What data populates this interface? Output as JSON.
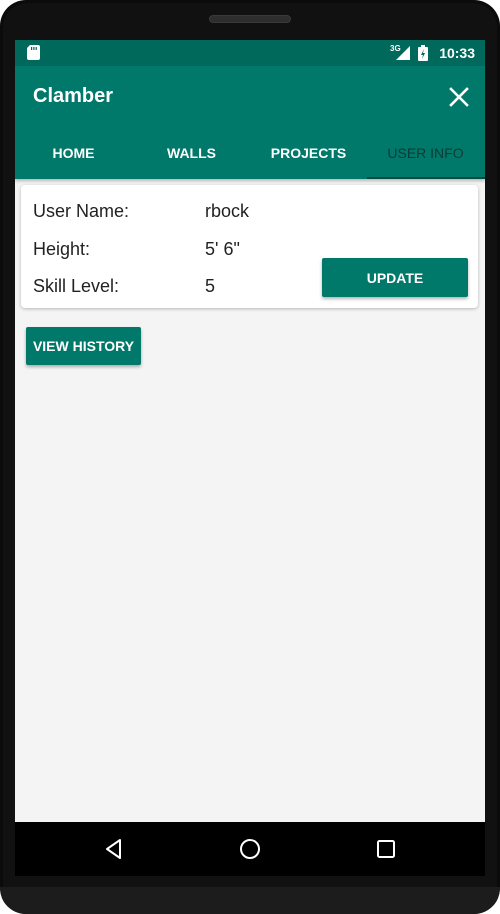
{
  "status_bar": {
    "network_type": "3G",
    "time": "10:33",
    "icons": [
      "sd-card-icon",
      "signal-icon",
      "battery-icon"
    ]
  },
  "app_bar": {
    "title": "Clamber",
    "close_icon": "close-icon"
  },
  "tabs": [
    {
      "label": "HOME",
      "active": false
    },
    {
      "label": "WALLS",
      "active": false
    },
    {
      "label": "PROJECTS",
      "active": false
    },
    {
      "label": "USER INFO",
      "active": true
    }
  ],
  "user_info": {
    "fields": [
      {
        "label": "User Name:",
        "value": "rbock"
      },
      {
        "label": "Height:",
        "value": "5' 6\""
      },
      {
        "label": "Skill Level:",
        "value": "5"
      }
    ],
    "update_label": "UPDATE"
  },
  "history": {
    "button_label": "VIEW HISTORY"
  },
  "nav_bar": {
    "icons": [
      "back-icon",
      "home-icon",
      "recents-icon"
    ]
  },
  "colors": {
    "primary": "#00796b",
    "primary_dark": "#00695c",
    "background": "#f4f4f4"
  }
}
